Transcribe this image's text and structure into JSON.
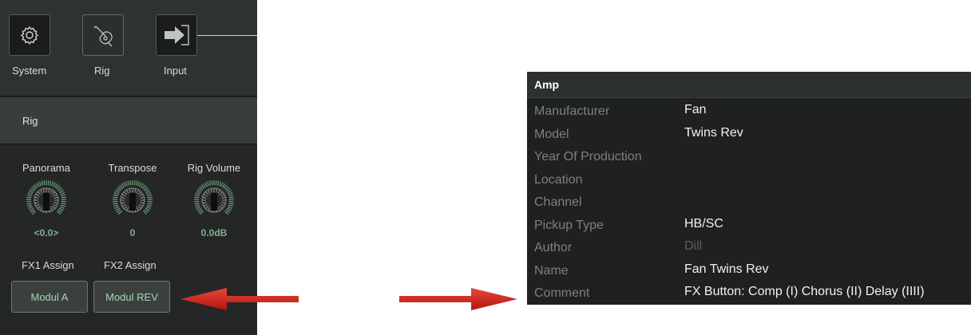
{
  "toolbar": {
    "items": [
      {
        "label": "System",
        "icon": "gear-icon"
      },
      {
        "label": "Rig",
        "icon": "guitar-icon"
      },
      {
        "label": "Input",
        "icon": "input-arrow-icon"
      }
    ]
  },
  "section": {
    "title": "Rig"
  },
  "controls": {
    "knobs": [
      {
        "label": "Panorama",
        "value": "<0.0>"
      },
      {
        "label": "Transpose",
        "value": "0"
      },
      {
        "label": "Rig Volume",
        "value": "0.0dB"
      }
    ],
    "assigns": [
      {
        "label": "FX1 Assign",
        "button": "Modul A"
      },
      {
        "label": "FX2 Assign",
        "button": "Modul REV"
      }
    ]
  },
  "amp": {
    "title": "Amp",
    "rows": [
      {
        "key": "Manufacturer",
        "value": "Fan"
      },
      {
        "key": "Model",
        "value": "Twins Rev"
      },
      {
        "key": "Year Of Production",
        "value": ""
      },
      {
        "key": "Location",
        "value": ""
      },
      {
        "key": "Channel",
        "value": ""
      },
      {
        "key": "Pickup Type",
        "value": "HB/SC"
      },
      {
        "key": "Author",
        "value": "Dill"
      },
      {
        "key": "Name",
        "value": "Fan Twins Rev"
      },
      {
        "key": "Comment",
        "value": "FX Button: Comp (I) Chorus (II) Delay (IIII)"
      }
    ]
  },
  "colors": {
    "panel_bg": "#252626",
    "accent_green": "#7fb08c",
    "arrow_red": "#d4231e"
  }
}
